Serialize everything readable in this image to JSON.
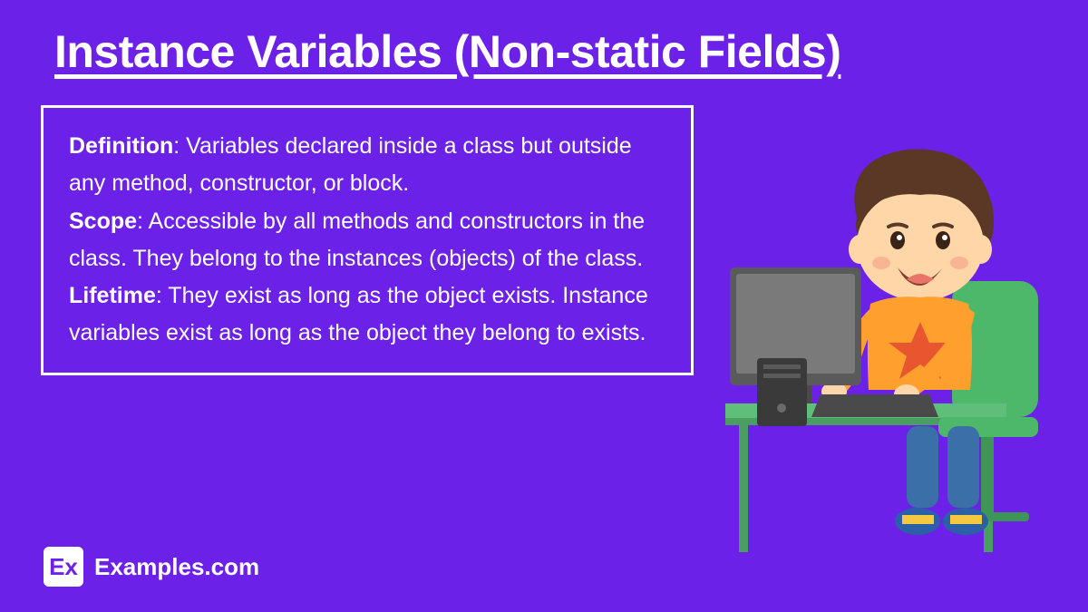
{
  "title": "Instance Variables (Non-static Fields)",
  "content": {
    "definition_label": "Definition",
    "definition_text": ": Variables declared inside a class but outside any method, constructor, or block.",
    "scope_label": "Scope",
    "scope_text": ": Accessible by all methods and constructors in the class. They belong to the instances (objects) of the class.",
    "lifetime_label": "Lifetime",
    "lifetime_text": ": They exist as long as the object exists. Instance variables exist as long as the object they belong to exists."
  },
  "footer": {
    "logo": "Ex",
    "site": "Examples.com"
  }
}
